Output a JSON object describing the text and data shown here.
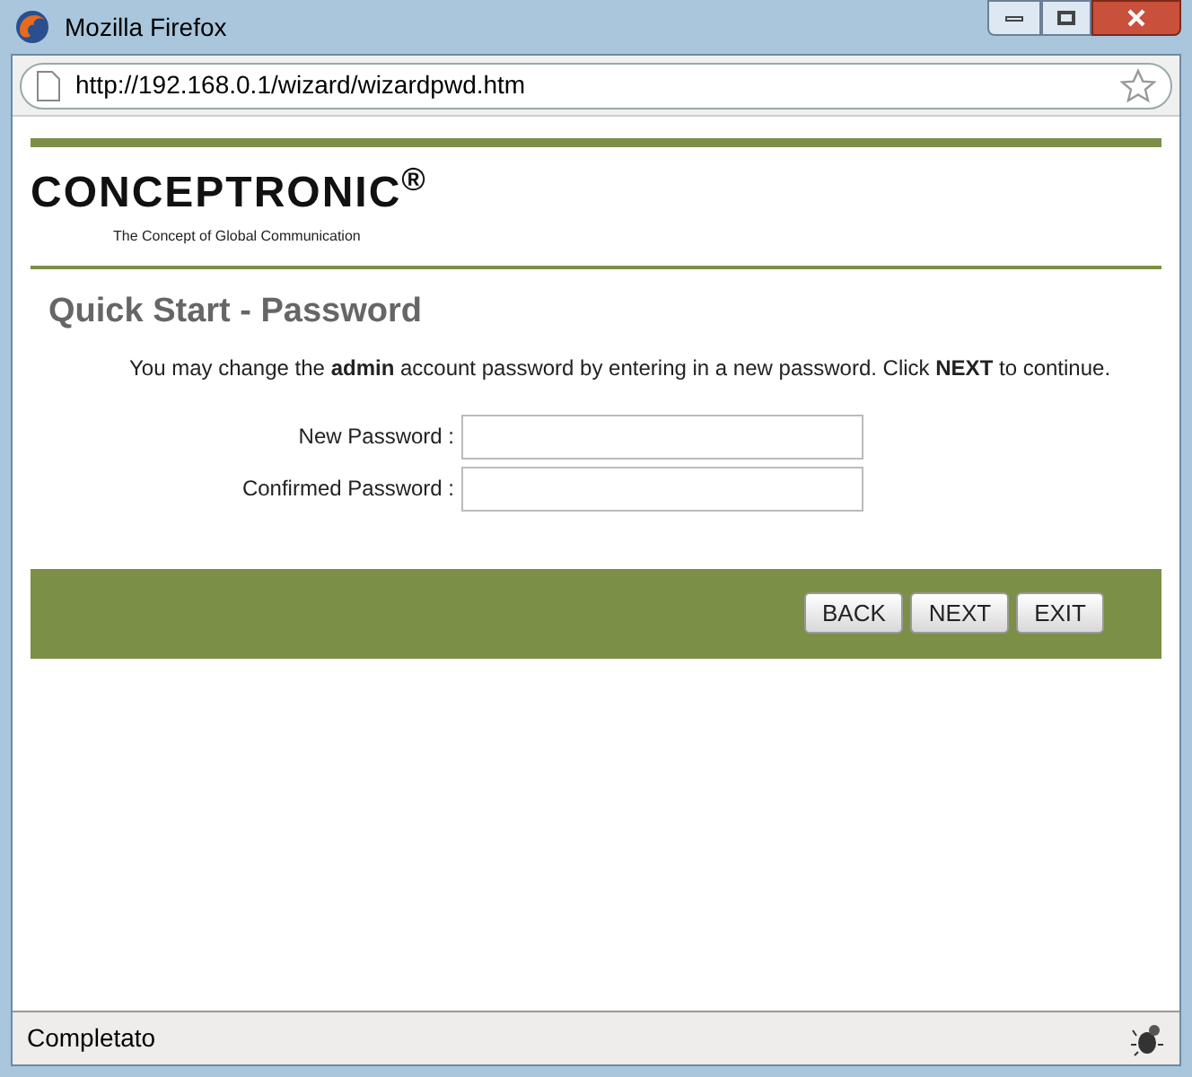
{
  "window": {
    "title": "Mozilla Firefox"
  },
  "address_bar": {
    "url": "http://192.168.0.1/wizard/wizardpwd.htm"
  },
  "page": {
    "logo": "CONCEPTRONIC$^{®}$",
    "tagline": "The Concept of Global Communication",
    "heading": "Quick Start - Password",
    "intro": "You may change the **admin** account password by entering in a new password. Click **NEXT** to continue.",
    "fields": [
      {
        "label": "New Password :"
      },
      {
        "label": "Confirmed Password :"
      }
    ],
    "buttons": [
      "BACK",
      "NEXT",
      "EXIT"
    ]
  },
  "status_bar": {
    "text": "Completato"
  }
}
